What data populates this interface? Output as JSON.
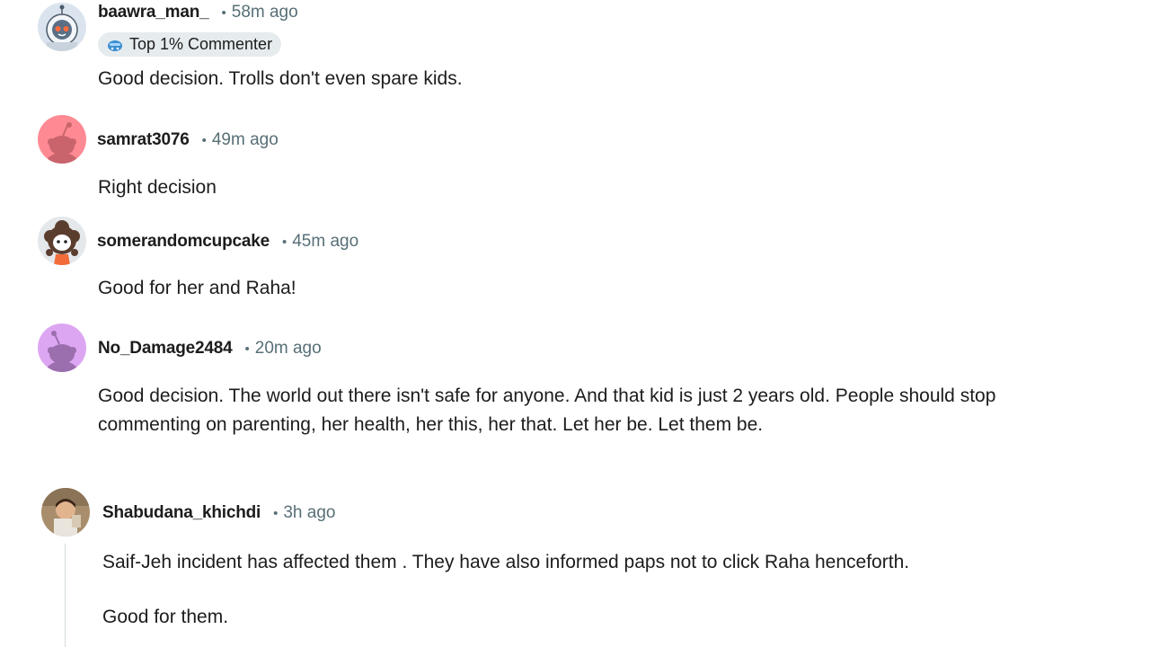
{
  "comments": [
    {
      "username": "baawra_man_",
      "separator": "•",
      "time": "58m ago",
      "flair": "Top 1% Commenter",
      "avatar_icon": "astronaut-snoo-avatar-icon",
      "lines": [
        "Good decision. Trolls don't even spare kids."
      ]
    },
    {
      "username": "samrat3076",
      "separator": "•",
      "time": "49m ago",
      "avatar_icon": "default-snoo-avatar-icon",
      "avatar_color": "#ff8a94",
      "lines": [
        "Right decision"
      ]
    },
    {
      "username": "somerandomcupcake",
      "separator": "•",
      "time": "45m ago",
      "avatar_icon": "curly-hair-snoo-avatar-icon",
      "lines": [
        "Good for her and Raha!"
      ]
    },
    {
      "username": "No_Damage2484",
      "separator": "•",
      "time": "20m ago",
      "avatar_icon": "default-snoo-avatar-icon",
      "avatar_color": "#dda6f2",
      "lines": [
        "Good decision. The world out there isn't safe for anyone. And that kid is just 2 years old. People should stop",
        "commenting on parenting, her health, her this, her that. Let her be. Let them be."
      ]
    },
    {
      "username": "Shabudana_khichdi",
      "separator": "•",
      "time": "3h ago",
      "avatar_icon": "photo-avatar-icon",
      "lines": [
        "Saif-Jeh incident has affected them . They have also informed paps not to click Raha henceforth.",
        "Good for them."
      ]
    }
  ]
}
